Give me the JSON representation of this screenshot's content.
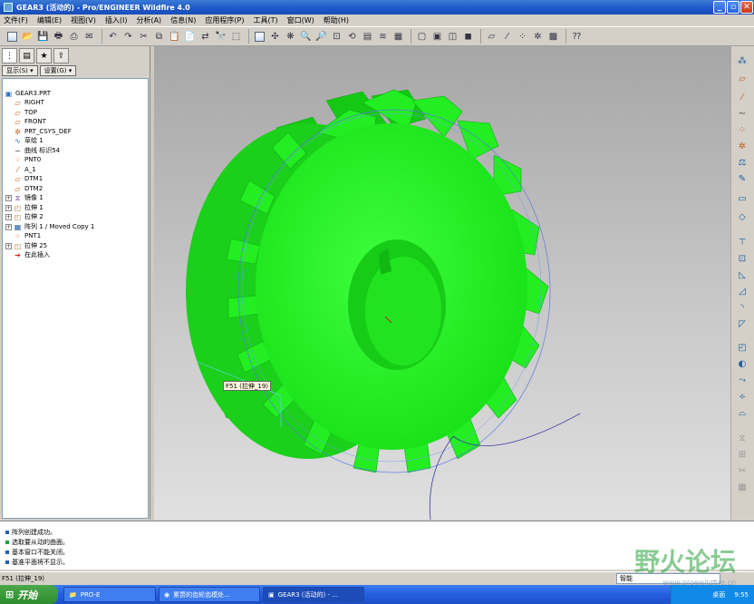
{
  "window": {
    "title": "GEAR3 (活动的) - Pro/ENGINEER Wildfire 4.0"
  },
  "menu": [
    "文件(F)",
    "编辑(E)",
    "视图(V)",
    "插入(I)",
    "分析(A)",
    "信息(N)",
    "应用程序(P)",
    "工具(T)",
    "窗口(W)",
    "帮助(H)"
  ],
  "panel": {
    "show_label": "显示(S) ▾",
    "settings_label": "设置(G) ▾"
  },
  "tree": {
    "root": "GEAR3.PRT",
    "items": [
      "RIGHT",
      "TOP",
      "FRONT",
      "PRT_CSYS_DEF",
      "草绘 1",
      "曲线 标识54",
      "PNT0",
      "A_1",
      "DTM1",
      "DTM2",
      "镜像 1",
      "拉伸 1",
      "拉伸 2",
      "阵列 1 / Moved Copy 1",
      "PNT1",
      "拉伸 25",
      "在此插入"
    ]
  },
  "viewport": {
    "tooltip": "F51 (拉伸_19)",
    "model_color": "#22ee22"
  },
  "messages": [
    "阵列创建成功。",
    "选取要从动的曲面。",
    "基本窗口不能关闭。",
    "基准平面将不显示。"
  ],
  "status": {
    "selection": "F51 (拉伸_19)",
    "filter": "智能"
  },
  "taskbar": {
    "start": "开始",
    "tasks": [
      "PRO-E",
      "累赘的齿轮齿模处...",
      "GEAR3 (活动的) - ..."
    ],
    "tray_time": "9:55",
    "tray_label": "桌面"
  },
  "watermark": {
    "text": "野火论坛",
    "url": "www.proewildfire.cn"
  }
}
